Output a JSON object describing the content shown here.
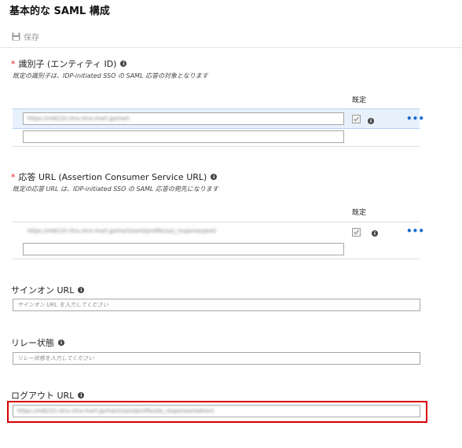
{
  "header": {
    "title": "基本的な SAML 構成",
    "save_label": "保存"
  },
  "identifier": {
    "required_mark": "*",
    "label": "識別子 (エンティティ ID)",
    "info": "i",
    "description": "既定の識別子は、IDP-initiated SSO の SAML 応答の対象となります",
    "default_header": "既定",
    "row_value": "https://m8210.ntra.ntra-mart.jp/mart",
    "row_default_checked": true,
    "more": "•••"
  },
  "reply_url": {
    "required_mark": "*",
    "label": "応答 URL (Assertion Consumer Service URL)",
    "info": "i",
    "description": "既定の応答 URL は、IDP-initiated SSO の SAML 応答の宛先になります",
    "default_header": "既定",
    "row_value": "https://m8210.ntra.ntra-mart.jp/mart/saml/profile/sso_response/post",
    "row_default_checked": true,
    "more": "•••"
  },
  "sign_on_url": {
    "label": "サインオン URL",
    "info": "i",
    "placeholder": "サインオン URL を入力してください"
  },
  "relay_state": {
    "label": "リレー状態",
    "info": "i",
    "placeholder": "リレー状態を入力してください"
  },
  "logout_url": {
    "label": "ログアウト URL",
    "info": "i",
    "value": "https://m8210.ntra.ntra-mart.jp/mart/saml/profile/slo_response/redirect"
  },
  "colors": {
    "required": "#e02020",
    "link": "#1b6fd1",
    "selected_row": "#e7f1fb",
    "highlight": "#d60000"
  }
}
